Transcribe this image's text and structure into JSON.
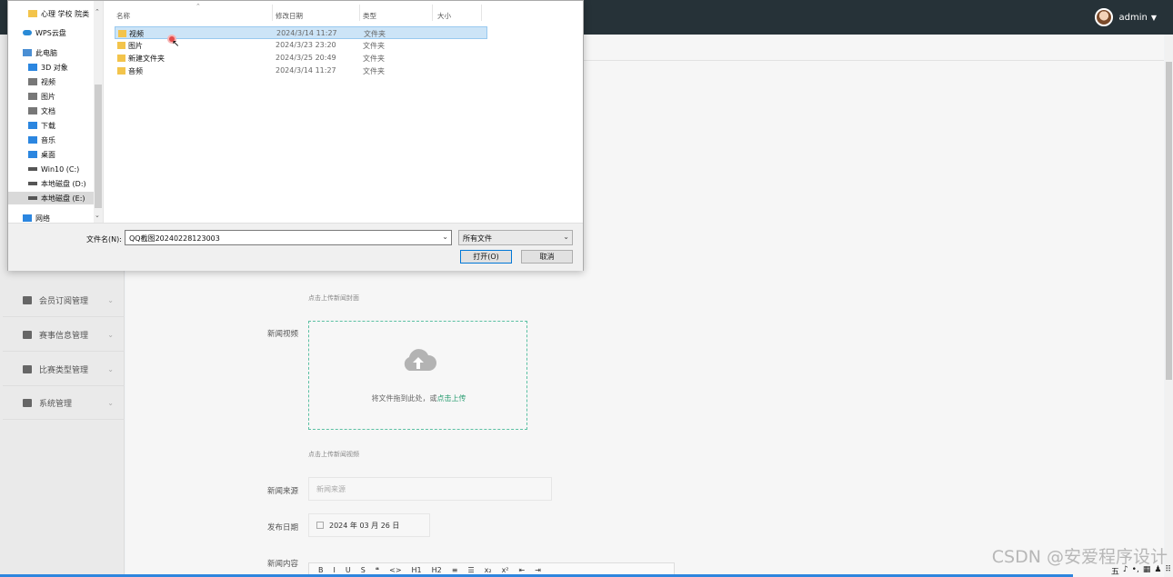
{
  "topbar": {
    "username": "admin",
    "caret": "▼"
  },
  "sidebar": {
    "items": [
      {
        "label": "会员订阅管理",
        "icon": "briefcase-icon"
      },
      {
        "label": "赛事信息管理",
        "icon": "folder-icon"
      },
      {
        "label": "比赛类型管理",
        "icon": "grid-icon"
      },
      {
        "label": "系统管理",
        "icon": "clipboard-icon"
      }
    ]
  },
  "form": {
    "cover_hint": "点击上传新闻封面",
    "video_label": "新闻视频",
    "drop_text": "将文件拖到此处，或",
    "drop_link": "点击上传",
    "video_hint": "点击上传新闻视频",
    "source_label": "新闻来源",
    "source_placeholder": "新闻来源",
    "date_label": "发布日期",
    "date_value": "2024 年 03 月 26 日",
    "content_label": "新闻内容",
    "editor_tools": [
      "B",
      "I",
      "U",
      "S",
      "❝",
      "<>",
      "H1",
      "H2",
      "≡",
      "☰",
      "x₂",
      "x²",
      "⇤",
      "⇥"
    ]
  },
  "dialog": {
    "nav": [
      {
        "label": "心理 学校 院类",
        "icon": "folder-icon",
        "cls": "fold"
      },
      {
        "label": "WPS云盘",
        "icon": "cloud-icon",
        "cls": "cloudi"
      },
      {
        "label": "此电脑",
        "icon": "computer-icon",
        "cls": "pc"
      },
      {
        "label": "3D 对象",
        "icon": "cube-icon",
        "cls": "blue"
      },
      {
        "label": "视频",
        "icon": "video-icon",
        "cls": "gray"
      },
      {
        "label": "图片",
        "icon": "image-icon",
        "cls": "gray"
      },
      {
        "label": "文档",
        "icon": "document-icon",
        "cls": "gray"
      },
      {
        "label": "下载",
        "icon": "download-icon",
        "cls": "blue"
      },
      {
        "label": "音乐",
        "icon": "music-icon",
        "cls": "blue"
      },
      {
        "label": "桌面",
        "icon": "desktop-icon",
        "cls": "blue"
      },
      {
        "label": "Win10 (C:)",
        "icon": "drive-icon",
        "cls": "drive"
      },
      {
        "label": "本地磁盘 (D:)",
        "icon": "drive-icon",
        "cls": "drive"
      },
      {
        "label": "本地磁盘 (E:)",
        "icon": "drive-icon",
        "cls": "drive"
      },
      {
        "label": "网络",
        "icon": "network-icon",
        "cls": "blue"
      }
    ],
    "columns": {
      "name": "名称",
      "date": "修改日期",
      "type": "类型",
      "size": "大小"
    },
    "files": [
      {
        "name": "视频",
        "date": "2024/3/14 11:27",
        "type": "文件夹"
      },
      {
        "name": "图片",
        "date": "2024/3/23 23:20",
        "type": "文件夹"
      },
      {
        "name": "新建文件夹",
        "date": "2024/3/25 20:49",
        "type": "文件夹"
      },
      {
        "name": "音频",
        "date": "2024/3/14 11:27",
        "type": "文件夹"
      }
    ],
    "filename_label": "文件名(N):",
    "filename_value": "QQ截图20240228123003",
    "filetype_value": "所有文件",
    "open_label": "打开(O)",
    "cancel_label": "取消"
  },
  "watermark": "CSDN @安爱程序设计",
  "tray": [
    "五",
    "♪",
    "•,",
    "▦",
    "♟",
    "⠿"
  ]
}
